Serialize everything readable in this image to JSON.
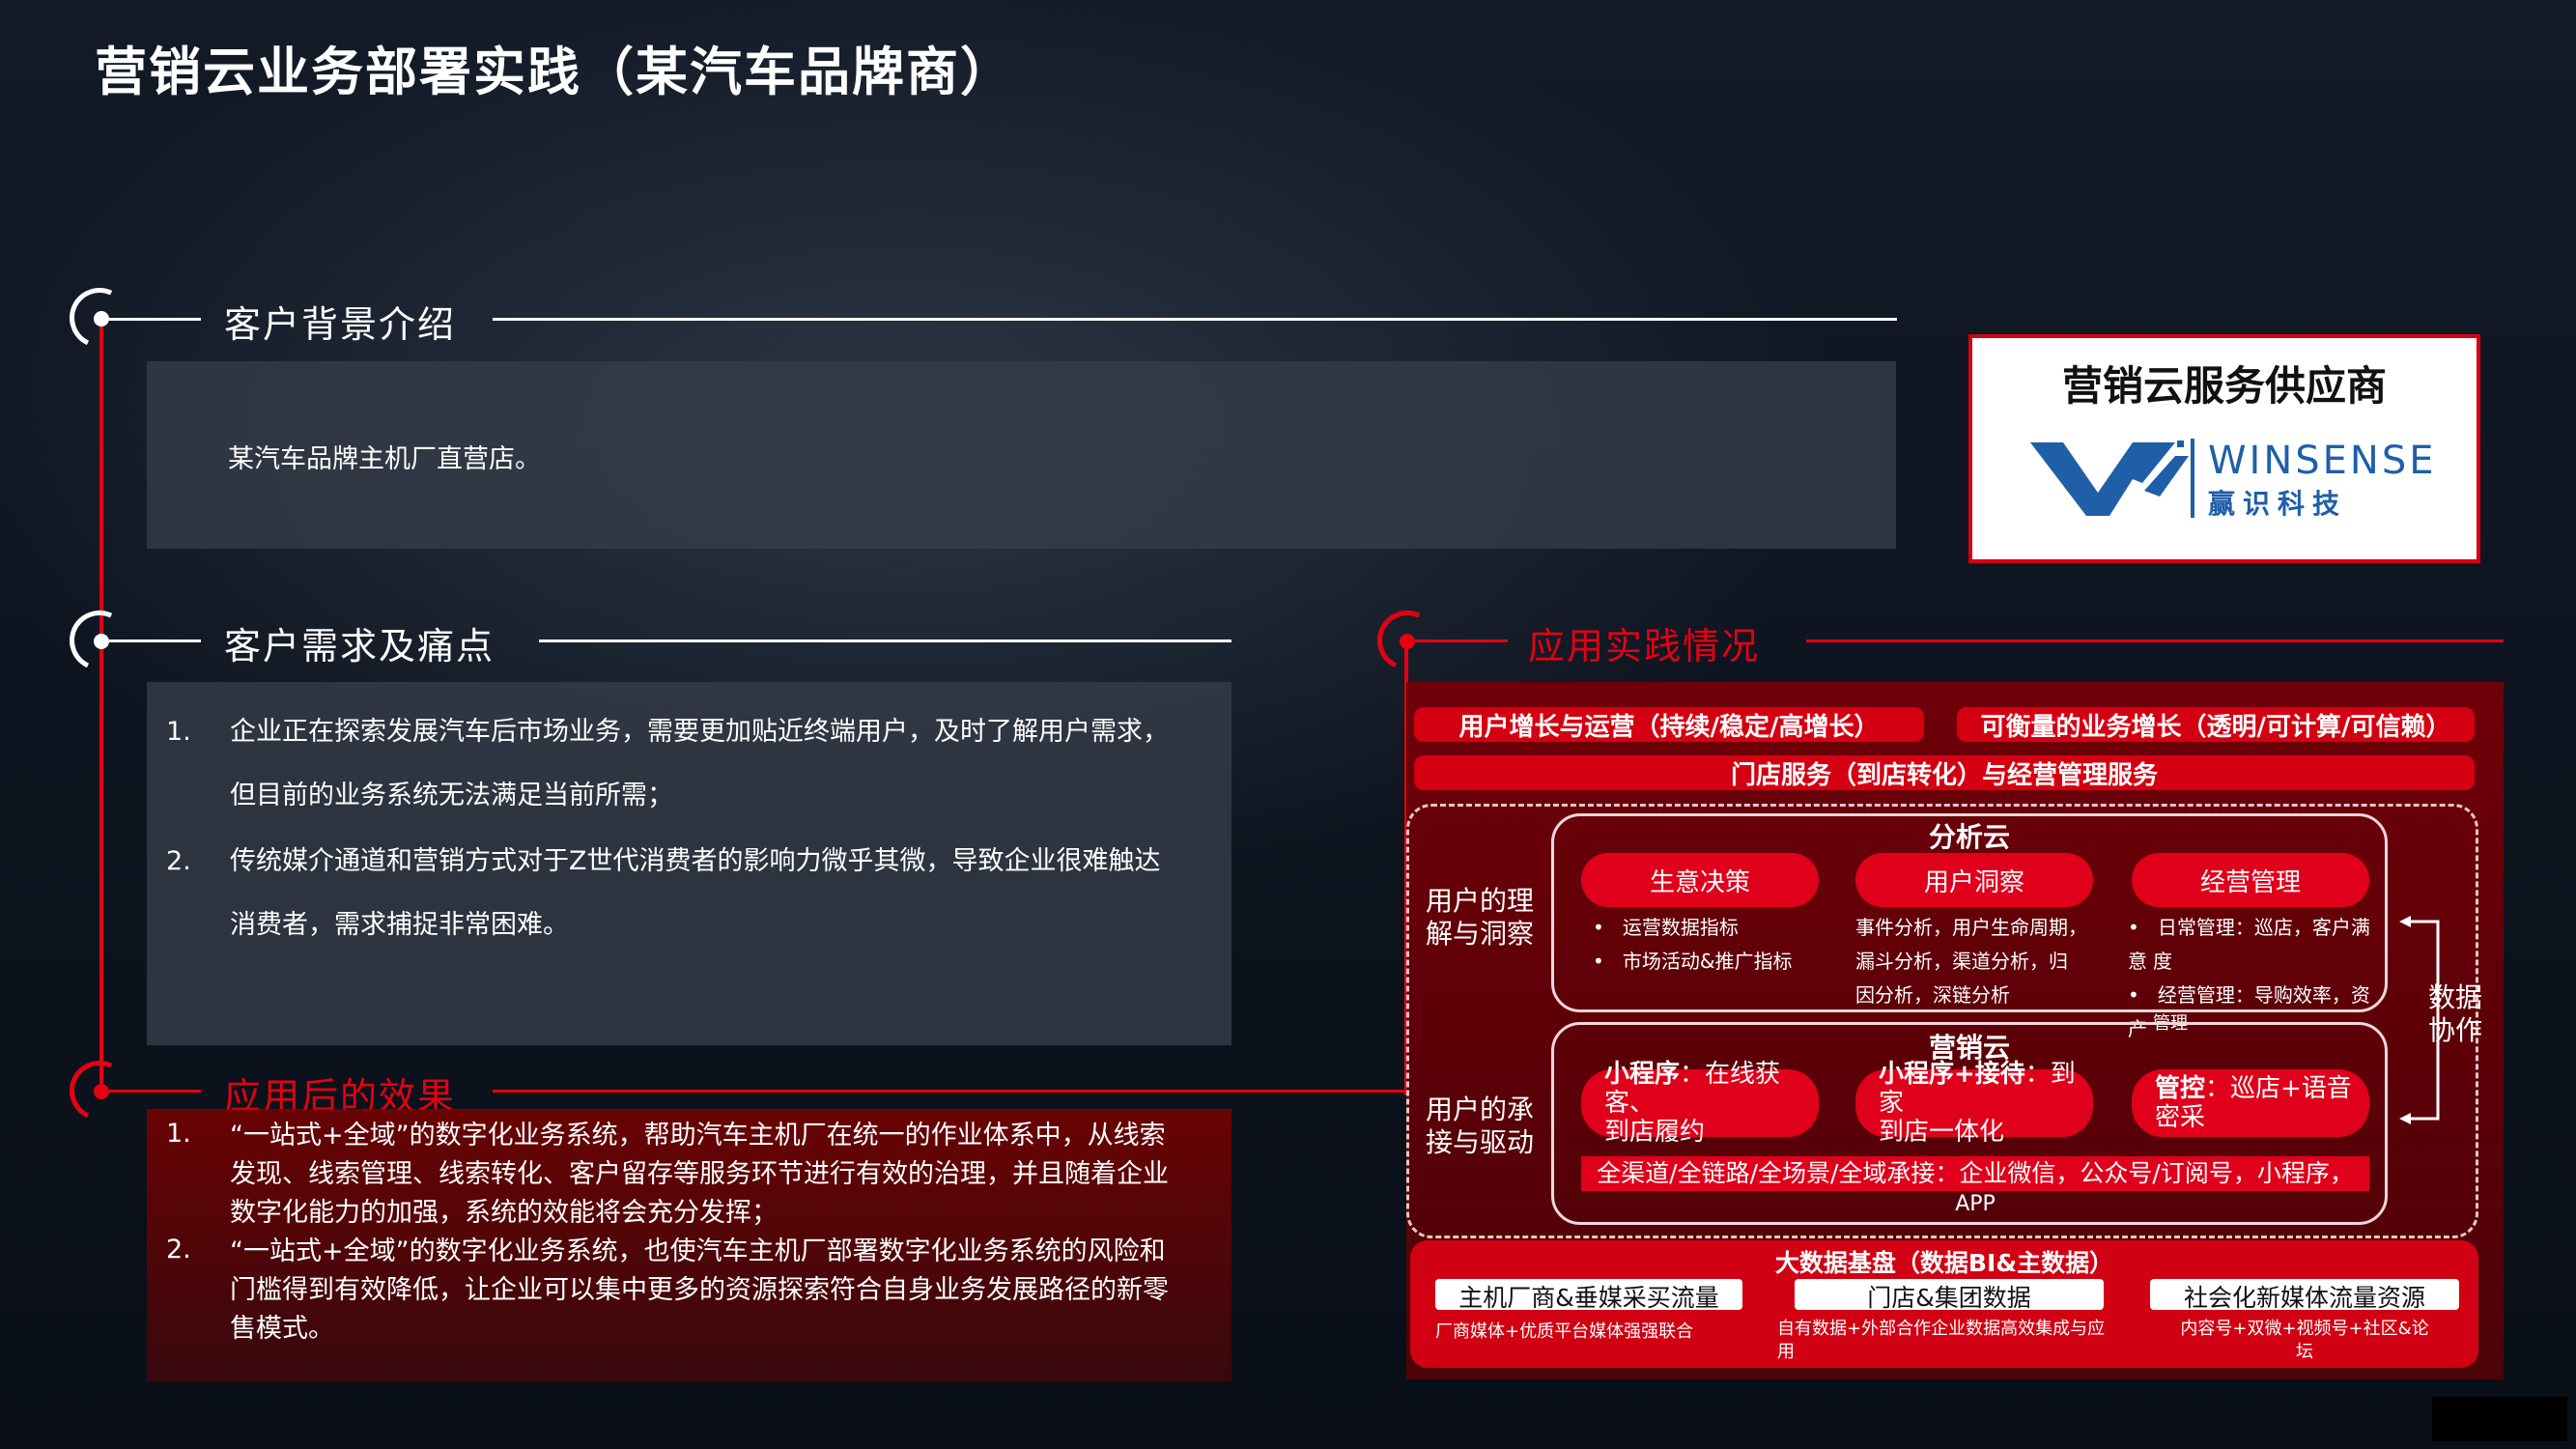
{
  "title": "营销云业务部署实践（某汽车品牌商）",
  "sections": {
    "background": {
      "title": "客户背景介绍",
      "text": "某汽车品牌主机厂直营店。"
    },
    "needs": {
      "title": "客户需求及痛点",
      "items": [
        {
          "num": "1.",
          "line1": "企业正在探索发展汽车后市场业务，需要更加贴近终端用户，及时了解用户需求，",
          "line2": "但目前的业务系统无法满足当前所需；"
        },
        {
          "num": "2.",
          "line1": "传统媒介通道和营销方式对于Z世代消费者的影响力微乎其微，导致企业很难触达",
          "line2": "消费者，需求捕捉非常困难。"
        }
      ]
    },
    "effects": {
      "title": "应用后的效果",
      "items": [
        {
          "num": "1.",
          "lines": [
            "“一站式+全域”的数字化业务系统，帮助汽车主机厂在统一的作业体系中，从线索",
            "发现、线索管理、线索转化、客户留存等服务环节进行有效的治理，并且随着企业",
            "数字化能力的加强，系统的效能将会充分发挥；"
          ]
        },
        {
          "num": "2.",
          "lines": [
            "“一站式+全域”的数字化业务系统，也使汽车主机厂部署数字化业务系统的风险和",
            "门槛得到有效降低，让企业可以集中更多的资源探索符合自身业务发展路径的新零",
            "售模式。"
          ]
        }
      ]
    }
  },
  "vendor": {
    "title": "营销云服务供应商",
    "logo_en": "WINSENSE",
    "logo_cn": "赢识科技"
  },
  "practice": {
    "title": "应用实践情况",
    "top_left": "用户增长与运营（持续/稳定/高增长）",
    "top_right": "可衡量的业务增长（透明/可计算/可信赖）",
    "store_service": "门店服务（到店转化）与经营管理服务",
    "analysis_label": "用户的理解与洞察",
    "analysis_title": "分析云",
    "analysis_items": [
      {
        "name": "生意决策",
        "bullets": [
          "运营数据指标",
          "市场活动&推广指标"
        ]
      },
      {
        "name": "用户洞察",
        "desc": [
          "事件分析，用户生命周期，",
          "漏斗分析，渠道分析，归",
          "因分析，深链分析"
        ]
      },
      {
        "name": "经营管理",
        "bullets": [
          "日常管理：巡店，客户满意",
          "度",
          "经营管理：导购效率，资产",
          "管理"
        ]
      }
    ],
    "marketing_label": "用户的承接与驱动",
    "marketing_title": "营销云",
    "marketing_items": [
      {
        "bold": "小程序",
        "rest": "：在线获客、",
        "line2": "到店履约"
      },
      {
        "bold": "小程序+接待",
        "rest": "：到家",
        "line2": "到店一体化"
      },
      {
        "bold": "管控",
        "rest": "：巡店+语音",
        "line2": "密采"
      }
    ],
    "channels": "全渠道/全链路/全场景/全域承接：企业微信，公众号/订阅号，小程序，",
    "channels_2": "APP",
    "data_collab": "数据协作",
    "bigdata_title": "大数据基盘（数据BI&主数据）",
    "bigdata_items": [
      {
        "name": "主机厂商&垂媒采买流量",
        "desc": "厂商媒体+优质平台媒体强强联合",
        "desc2": ""
      },
      {
        "name": "门店&集团数据",
        "desc": "自有数据+外部合作企业数据高效集成与应",
        "desc2": "用"
      },
      {
        "name": "社会化新媒体流量资源",
        "desc": "内容号+双微+视频号+社区&论",
        "desc2": "坛"
      }
    ]
  },
  "colors": {
    "accent": "#e60012",
    "panel": "#343c48",
    "bg": "#0e1520"
  }
}
